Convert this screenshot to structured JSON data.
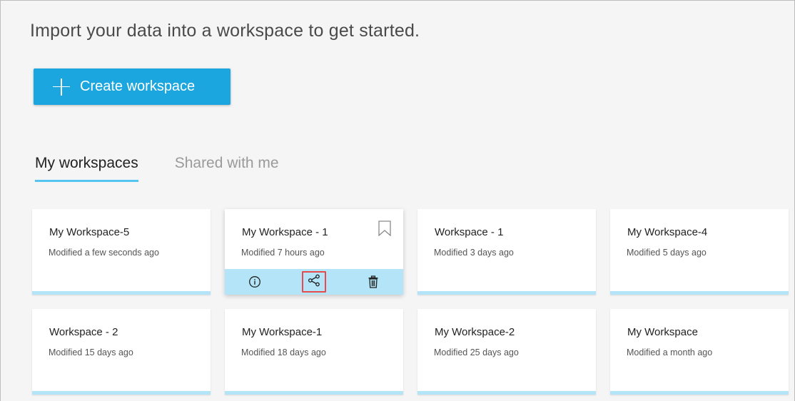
{
  "headline": "Import your data into a workspace to get started.",
  "create_button": {
    "label": "Create workspace",
    "icon": "plus-icon"
  },
  "tabs": [
    {
      "label": "My workspaces",
      "active": true
    },
    {
      "label": "Shared with me",
      "active": false
    }
  ],
  "workspaces": [
    {
      "title": "My Workspace-5",
      "modified": "Modified a few seconds ago"
    },
    {
      "title": "My Workspace - 1",
      "modified": "Modified 7 hours ago",
      "hover": true
    },
    {
      "title": "Workspace - 1",
      "modified": "Modified 3 days ago"
    },
    {
      "title": "My Workspace-4",
      "modified": "Modified 5 days ago"
    },
    {
      "title": "Workspace - 2",
      "modified": "Modified 15 days ago"
    },
    {
      "title": "My Workspace-1",
      "modified": "Modified 18 days ago"
    },
    {
      "title": "My Workspace-2",
      "modified": "Modified 25 days ago"
    },
    {
      "title": "My Workspace",
      "modified": "Modified a month ago"
    }
  ],
  "card_actions": [
    "info-icon",
    "share-icon",
    "trash-icon"
  ],
  "colors": {
    "accent": "#1ba6e0",
    "tab_underline": "#55c4f0",
    "card_bar": "#b3e4f7",
    "highlight": "#e84a4a"
  }
}
